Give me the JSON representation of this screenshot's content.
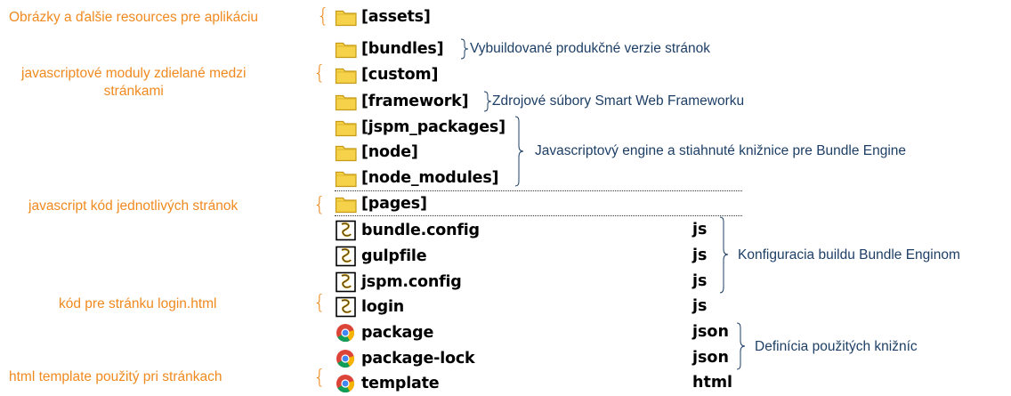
{
  "colors": {
    "left_annotation": "#f08a1f",
    "right_annotation": "#1d3f66",
    "folder": "#f5d24a",
    "folder_edge": "#c59a16"
  },
  "left_annotations": [
    {
      "text": "Obrázky a ďalšie resources pre aplikáciu"
    },
    {
      "line1": "javascriptové moduly zdielané medzi",
      "line2": "stránkami"
    },
    {
      "text": "javascript kód jednotlivých stránok"
    },
    {
      "text": "kód pre stránku login.html"
    },
    {
      "text": "html template použitý pri stránkach"
    }
  ],
  "brace_glyph": "{",
  "files": [
    {
      "name": "[assets]",
      "icon": "folder-icon",
      "ext": ""
    },
    {
      "name": "[bundles]",
      "icon": "folder-icon",
      "ext": ""
    },
    {
      "name": "[custom]",
      "icon": "folder-icon",
      "ext": ""
    },
    {
      "name": "[framework]",
      "icon": "folder-icon",
      "ext": ""
    },
    {
      "name": "[jspm_packages]",
      "icon": "folder-icon",
      "ext": ""
    },
    {
      "name": "[node]",
      "icon": "folder-icon",
      "ext": ""
    },
    {
      "name": "[node_modules]",
      "icon": "folder-icon",
      "ext": ""
    },
    {
      "name": "[pages]",
      "icon": "folder-icon",
      "ext": ""
    },
    {
      "name": "bundle.config",
      "icon": "script-file-icon",
      "ext": "js"
    },
    {
      "name": "gulpfile",
      "icon": "script-file-icon",
      "ext": "js"
    },
    {
      "name": "jspm.config",
      "icon": "script-file-icon",
      "ext": "js"
    },
    {
      "name": "login",
      "icon": "script-file-icon",
      "ext": "js"
    },
    {
      "name": "package",
      "icon": "chrome-icon",
      "ext": "json"
    },
    {
      "name": "package-lock",
      "icon": "chrome-icon",
      "ext": "json"
    },
    {
      "name": "template",
      "icon": "chrome-icon",
      "ext": "html"
    }
  ],
  "right_annotations": [
    {
      "text": "Vybuildované produkčné verzie stránok"
    },
    {
      "text": "Zdrojové súbory Smart Web Frameworku"
    },
    {
      "text": "Javascriptový engine a stiahnuté knižnice pre Bundle Engine"
    },
    {
      "text": "Konfiguracia buildu Bundle Enginom"
    },
    {
      "text": "Definícia použitých knižníc"
    }
  ]
}
